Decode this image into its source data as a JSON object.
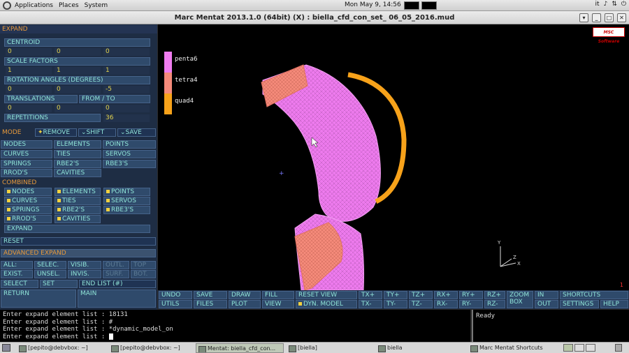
{
  "topbar": {
    "menus": [
      "Applications",
      "Places",
      "System"
    ],
    "clock": "Mon May  9, 14:56",
    "kbd": "it"
  },
  "window": {
    "title": "Marc Mentat 2013.1.0 (64bit) (X) : biella_cfd_con_set_ 06_05_2016.mud"
  },
  "left": {
    "expand": "EXPAND",
    "centroid": "CENTROID",
    "centroid_vals": [
      "0",
      "0",
      "0"
    ],
    "scale": "SCALE FACTORS",
    "scale_vals": [
      "1",
      "1",
      "1"
    ],
    "rotation": "ROTATION ANGLES (DEGREES)",
    "rotation_vals": [
      "0",
      "0",
      "-5"
    ],
    "translations": "TRANSLATIONS",
    "from_to": "FROM / TO",
    "translation_vals": [
      "0",
      "0",
      "0"
    ],
    "repetitions": "REPETITIONS",
    "repetitions_val": "36",
    "mode": "MODE",
    "remove": "REMOVE",
    "shift": "SHIFT",
    "save": "SAVE",
    "nodes": "NODES",
    "elements": "ELEMENTS",
    "points": "POINTS",
    "curves": "CURVES",
    "ties": "TIES",
    "servos": "SERVOS",
    "springs": "SPRINGS",
    "rbe2s": "RBE2'S",
    "rbe3s": "RBE3'S",
    "rrods": "RROD'S",
    "cavities": "CAVITIES",
    "combined": "COMBINED",
    "c_nodes": "NODES",
    "c_elements": "ELEMENTS",
    "c_points": "POINTS",
    "c_curves": "CURVES",
    "c_ties": "TIES",
    "c_servos": "SERVOS",
    "c_springs": "SPRINGS",
    "c_rbe2s": "RBE2'S",
    "c_rbe3s": "RBE3'S",
    "c_rrods": "RROD'S",
    "c_cavities": "CAVITIES",
    "c_expand": "EXPAND",
    "reset": "RESET",
    "advanced": "ADVANCED EXPAND",
    "all": "ALL:",
    "selec": "SELEC.",
    "visib": "VISIB.",
    "outl": "OUTL.",
    "top": "TOP",
    "exist": "EXIST.",
    "unsel": "UNSEL.",
    "invis": "INVIS.",
    "surf": "SURF.",
    "bot": "BOT.",
    "select": "SELECT",
    "set": "SET",
    "end_list": "END LIST (#)",
    "return": "RETURN",
    "main": "MAIN"
  },
  "legend": [
    {
      "label": "penta6",
      "color": "#f07cf0"
    },
    {
      "label": "tetra4",
      "color": "#f58a7a"
    },
    {
      "label": "quad4",
      "color": "#f7a21a"
    }
  ],
  "viewport": {
    "logo": "MSC Software",
    "axis_x": "X",
    "axis_y": "Y",
    "axis_z": "Z",
    "number": "1"
  },
  "toolbar": {
    "row1": [
      "UNDO",
      "SAVE",
      "DRAW",
      "FILL",
      "RESET VIEW",
      "TX+",
      "TY+",
      "TZ+",
      "RX+",
      "RY+",
      "RZ+",
      "ZOOM BOX",
      "IN",
      "SHORTCUTS"
    ],
    "row2": [
      "UTILS",
      "FILES",
      "PLOT",
      "VIEW",
      "DYN. MODEL",
      "TX-",
      "TY-",
      "TZ-",
      "RX-",
      "RY-",
      "RZ-",
      "OUT",
      "SETTINGS",
      "HELP"
    ]
  },
  "console": {
    "lines": [
      "Enter expand element list :  18131",
      "Enter expand element list : #",
      "Enter expand element list : *dynamic_model_on",
      "Enter expand element list : "
    ],
    "status": "Ready"
  },
  "taskbar": [
    "[pepito@debvbox: ~]",
    "[pepito@debvbox: ~]",
    "Mentat: biella_cfd_con...",
    "[biella]",
    "biella",
    "Marc Mentat Shortcuts"
  ]
}
